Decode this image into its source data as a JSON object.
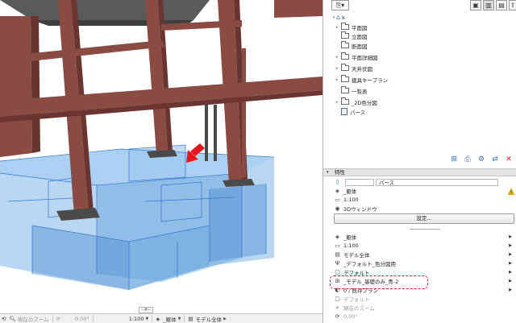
{
  "statusbar": {
    "zoom_label": "現在のズーム",
    "angle": "0.00°",
    "scale": "1:100",
    "layer_set": "_躯体",
    "model_view": "モデル全体"
  },
  "navigator": {
    "root": "k",
    "items": [
      {
        "label": "平面図"
      },
      {
        "label": "立面図"
      },
      {
        "label": "断面図"
      },
      {
        "label": "平面詳細図"
      },
      {
        "label": "天井伏図"
      },
      {
        "label": "建具キープラン"
      },
      {
        "label": "一覧表"
      },
      {
        "label": "_2D色分図"
      },
      {
        "label": "パース"
      }
    ]
  },
  "properties": {
    "header": "特性",
    "name_value": "パース",
    "layer": "_躯体",
    "scale": "1:100",
    "window": "3Dウィンドウ",
    "settings_button": "設定..."
  },
  "view_settings": [
    {
      "label": "_躯体"
    },
    {
      "label": "1:100"
    },
    {
      "label": "モデル全体"
    },
    {
      "label": "_デフォルト_色分図用"
    },
    {
      "label": "デフォルト"
    },
    {
      "label": "_モデル_基礎のみ_青-2"
    },
    {
      "label": "0 / 既存プラン"
    },
    {
      "label": "デフォルト"
    },
    {
      "label": "現在のズーム"
    },
    {
      "label": "0.00°"
    }
  ],
  "colors": {
    "highlight": "#d01c28",
    "arrow": "#e8141c",
    "column": "#8a4b42",
    "foundation": "#7fb6e8"
  }
}
